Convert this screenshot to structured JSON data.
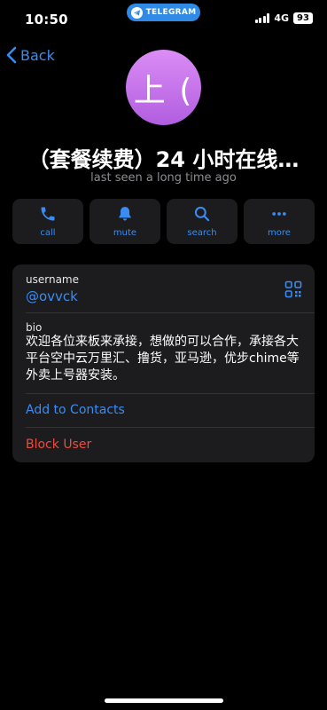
{
  "status_bar": {
    "time": "10:50",
    "app_pill": "TELEGRAM",
    "network": "4G",
    "battery": "93"
  },
  "nav": {
    "back_label": "Back"
  },
  "profile": {
    "avatar_initials": "上 (",
    "avatar_color_top": "#dc8df5",
    "avatar_color_bottom": "#b15de0",
    "name": "（套餐续费）24 小时在线…",
    "last_seen": "last seen a long time ago"
  },
  "actions": [
    {
      "label": "call",
      "icon": "phone-icon"
    },
    {
      "label": "mute",
      "icon": "bell-icon"
    },
    {
      "label": "search",
      "icon": "search-icon"
    },
    {
      "label": "more",
      "icon": "ellipsis-icon"
    }
  ],
  "info": {
    "username_label": "username",
    "username_value": "@ovvck",
    "bio_label": "bio",
    "bio_text": "欢迎各位来板来承接，想做的可以合作，承接各大平台空中云万里汇、撸货，亚马逊，优步chime等外卖上号器安装。",
    "add_contact": "Add to Contacts",
    "block_user": "Block User"
  },
  "colors": {
    "accent": "#3a8cf2",
    "danger": "#eb4d3d",
    "card": "#1c1c1e",
    "background": "#000000"
  }
}
